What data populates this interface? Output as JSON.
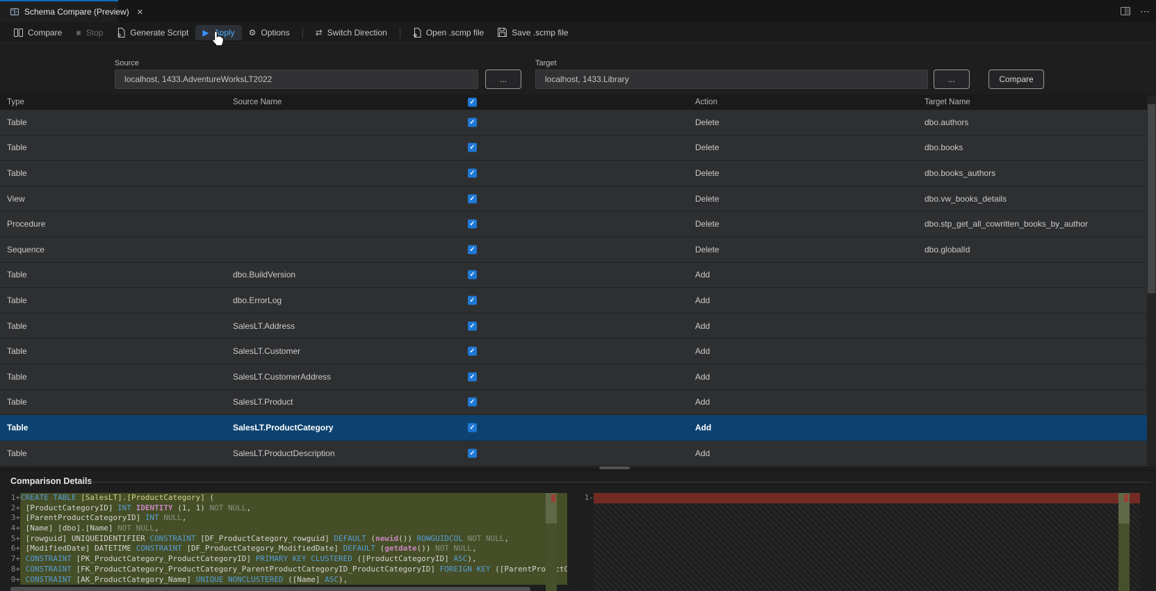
{
  "window": {
    "tab_title": "Schema Compare (Preview)"
  },
  "icons": {
    "close": "✕",
    "more": "⋯",
    "gear": "⚙",
    "stop": "■",
    "play": "▶",
    "switch": "⇄",
    "check": "✓"
  },
  "toolbar": {
    "compare": "Compare",
    "stop": "Stop",
    "generate_script": "Generate Script",
    "apply": "Apply",
    "options": "Options",
    "switch_direction": "Switch Direction",
    "open_scmp": "Open .scmp file",
    "save_scmp": "Save .scmp file"
  },
  "connection": {
    "source_label": "Source",
    "source_value": "localhost, 1433.AdventureWorksLT2022",
    "target_label": "Target",
    "target_value": "localhost, 1433.Library",
    "browse_label": "...",
    "compare_button": "Compare"
  },
  "grid": {
    "headers": {
      "type": "Type",
      "source_name": "Source Name",
      "action": "Action",
      "target_name": "Target Name"
    },
    "rows": [
      {
        "type": "Table",
        "source_name": "",
        "checked": true,
        "action": "Delete",
        "target_name": "dbo.authors",
        "selected": false
      },
      {
        "type": "Table",
        "source_name": "",
        "checked": true,
        "action": "Delete",
        "target_name": "dbo.books",
        "selected": false
      },
      {
        "type": "Table",
        "source_name": "",
        "checked": true,
        "action": "Delete",
        "target_name": "dbo.books_authors",
        "selected": false
      },
      {
        "type": "View",
        "source_name": "",
        "checked": true,
        "action": "Delete",
        "target_name": "dbo.vw_books_details",
        "selected": false
      },
      {
        "type": "Procedure",
        "source_name": "",
        "checked": true,
        "action": "Delete",
        "target_name": "dbo.stp_get_all_cowritten_books_by_author",
        "selected": false
      },
      {
        "type": "Sequence",
        "source_name": "",
        "checked": true,
        "action": "Delete",
        "target_name": "dbo.globalId",
        "selected": false
      },
      {
        "type": "Table",
        "source_name": "dbo.BuildVersion",
        "checked": true,
        "action": "Add",
        "target_name": "",
        "selected": false
      },
      {
        "type": "Table",
        "source_name": "dbo.ErrorLog",
        "checked": true,
        "action": "Add",
        "target_name": "",
        "selected": false
      },
      {
        "type": "Table",
        "source_name": "SalesLT.Address",
        "checked": true,
        "action": "Add",
        "target_name": "",
        "selected": false
      },
      {
        "type": "Table",
        "source_name": "SalesLT.Customer",
        "checked": true,
        "action": "Add",
        "target_name": "",
        "selected": false
      },
      {
        "type": "Table",
        "source_name": "SalesLT.CustomerAddress",
        "checked": true,
        "action": "Add",
        "target_name": "",
        "selected": false
      },
      {
        "type": "Table",
        "source_name": "SalesLT.Product",
        "checked": true,
        "action": "Add",
        "target_name": "",
        "selected": false
      },
      {
        "type": "Table",
        "source_name": "SalesLT.ProductCategory",
        "checked": true,
        "action": "Add",
        "target_name": "",
        "selected": true
      },
      {
        "type": "Table",
        "source_name": "SalesLT.ProductDescription",
        "checked": true,
        "action": "Add",
        "target_name": "",
        "selected": false
      }
    ]
  },
  "details": {
    "title": "Comparison Details",
    "right_gutter": "1-",
    "left_lines": [
      {
        "num": "1",
        "sign": "+",
        "segments": [
          {
            "t": "CREATE TABLE ",
            "c": "kw"
          },
          {
            "t": "[SalesLT].[ProductCategory] ",
            "c": "tbl"
          },
          {
            "t": "(",
            "c": "df"
          }
        ]
      },
      {
        "num": "2",
        "sign": "+",
        "segments": [
          {
            "t": " [ProductCategoryID] ",
            "c": "df"
          },
          {
            "t": "INT ",
            "c": "kw"
          },
          {
            "t": "IDENTITY ",
            "c": "fn"
          },
          {
            "t": "(1, 1) ",
            "c": "df"
          },
          {
            "t": "NOT NULL",
            "c": "dim"
          },
          {
            "t": ",",
            "c": "df"
          }
        ]
      },
      {
        "num": "3",
        "sign": "+",
        "segments": [
          {
            "t": " [ParentProductCategoryID] ",
            "c": "df"
          },
          {
            "t": "INT ",
            "c": "kw"
          },
          {
            "t": "NULL",
            "c": "dim"
          },
          {
            "t": ",",
            "c": "df"
          }
        ]
      },
      {
        "num": "4",
        "sign": "+",
        "segments": [
          {
            "t": " [Name] [dbo].[Name] ",
            "c": "df"
          },
          {
            "t": "NOT NULL",
            "c": "dim"
          },
          {
            "t": ",",
            "c": "df"
          }
        ]
      },
      {
        "num": "5",
        "sign": "+",
        "segments": [
          {
            "t": " [rowguid] UNIQUEIDENTIFIER ",
            "c": "df"
          },
          {
            "t": "CONSTRAINT ",
            "c": "kw"
          },
          {
            "t": "[DF_ProductCategory_rowguid] ",
            "c": "df"
          },
          {
            "t": "DEFAULT ",
            "c": "kw"
          },
          {
            "t": "(",
            "c": "df"
          },
          {
            "t": "newid",
            "c": "fn"
          },
          {
            "t": "()) ",
            "c": "df"
          },
          {
            "t": "ROWGUIDCOL ",
            "c": "kw"
          },
          {
            "t": "NOT NULL",
            "c": "dim"
          },
          {
            "t": ",",
            "c": "df"
          }
        ]
      },
      {
        "num": "6",
        "sign": "+",
        "segments": [
          {
            "t": " [ModifiedDate] DATETIME ",
            "c": "df"
          },
          {
            "t": "CONSTRAINT ",
            "c": "kw"
          },
          {
            "t": "[DF_ProductCategory_ModifiedDate] ",
            "c": "df"
          },
          {
            "t": "DEFAULT ",
            "c": "kw"
          },
          {
            "t": "(",
            "c": "df"
          },
          {
            "t": "getdate",
            "c": "fn"
          },
          {
            "t": "()) ",
            "c": "df"
          },
          {
            "t": "NOT NULL",
            "c": "dim"
          },
          {
            "t": ",",
            "c": "df"
          }
        ]
      },
      {
        "num": "7",
        "sign": "+",
        "segments": [
          {
            "t": " ",
            "c": "df"
          },
          {
            "t": "CONSTRAINT ",
            "c": "kw"
          },
          {
            "t": "[PK_ProductCategory_ProductCategoryID] ",
            "c": "df"
          },
          {
            "t": "PRIMARY KEY CLUSTERED ",
            "c": "kw"
          },
          {
            "t": "([ProductCategoryID] ",
            "c": "df"
          },
          {
            "t": "ASC",
            "c": "kw"
          },
          {
            "t": "),",
            "c": "df"
          }
        ]
      },
      {
        "num": "8",
        "sign": "+",
        "segments": [
          {
            "t": " ",
            "c": "df"
          },
          {
            "t": "CONSTRAINT ",
            "c": "kw"
          },
          {
            "t": "[FK_ProductCategory_ProductCategory_ParentProductCategoryID_ProductCategoryID] ",
            "c": "df"
          },
          {
            "t": "FOREIGN KEY ",
            "c": "kw"
          },
          {
            "t": "([ParentProductCategoryID]",
            "c": "df"
          }
        ]
      },
      {
        "num": "9",
        "sign": "+",
        "segments": [
          {
            "t": " ",
            "c": "df"
          },
          {
            "t": "CONSTRAINT ",
            "c": "kw"
          },
          {
            "t": "[AK_ProductCategory_Name] ",
            "c": "df"
          },
          {
            "t": "UNIQUE NONCLUSTERED ",
            "c": "kw"
          },
          {
            "t": "([Name] ",
            "c": "df"
          },
          {
            "t": "ASC",
            "c": "kw"
          },
          {
            "t": "),",
            "c": "df"
          }
        ]
      }
    ]
  }
}
